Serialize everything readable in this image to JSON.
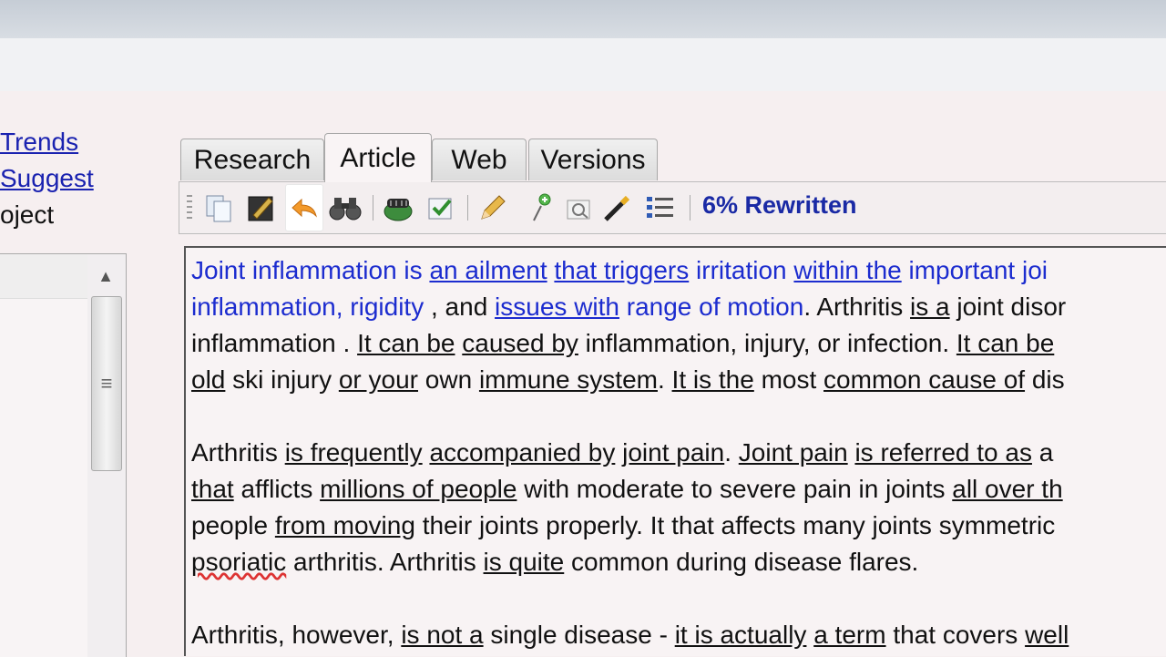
{
  "left": {
    "links": [
      "Trends",
      "Suggest"
    ],
    "static_text": "oject"
  },
  "tabs": [
    {
      "label": "Research",
      "active": false
    },
    {
      "label": "Article",
      "active": true
    },
    {
      "label": "Web",
      "active": false
    },
    {
      "label": "Versions",
      "active": false
    }
  ],
  "toolbar": {
    "icons": [
      "copy-icon",
      "edit-icon",
      "undo-arrow-icon",
      "binoculars-icon",
      "spinner-icon",
      "check-icon",
      "pencil-icon",
      "add-pin-icon",
      "zoom-icon",
      "magic-wand-icon",
      "list-icon"
    ],
    "status": "6% Rewritten",
    "status_color": "#1a2aa5"
  },
  "article": {
    "line1": [
      {
        "t": "Joint inflammation",
        "c": "blue"
      },
      {
        "t": "  is ",
        "c": "blue"
      },
      {
        "t": "an ailment",
        "c": "blue u"
      },
      {
        "t": " ",
        "c": ""
      },
      {
        "t": "that triggers",
        "c": "blue u"
      },
      {
        "t": " irritation ",
        "c": "blue"
      },
      {
        "t": "within the",
        "c": "blue u"
      },
      {
        "t": " important joi",
        "c": "blue"
      }
    ],
    "line2": [
      {
        "t": "inflammation, rigidity ",
        "c": "blue"
      },
      {
        "t": ", and ",
        "c": ""
      },
      {
        "t": "issues with",
        "c": "blue u"
      },
      {
        "t": " range of motion",
        "c": "blue"
      },
      {
        "t": ". Arthritis ",
        "c": ""
      },
      {
        "t": "is a",
        "c": "u"
      },
      {
        "t": " joint disor",
        "c": ""
      }
    ],
    "line3": [
      {
        "t": "inflammation .  ",
        "c": ""
      },
      {
        "t": "It can be",
        "c": "u"
      },
      {
        "t": " ",
        "c": ""
      },
      {
        "t": "caused by",
        "c": "u"
      },
      {
        "t": " inflammation, injury, or infection.  ",
        "c": ""
      },
      {
        "t": "It can be",
        "c": "u"
      }
    ],
    "line4": [
      {
        "t": "old",
        "c": "u"
      },
      {
        "t": " ski injury ",
        "c": ""
      },
      {
        "t": "or your",
        "c": "u"
      },
      {
        "t": " own ",
        "c": ""
      },
      {
        "t": "immune system",
        "c": "u"
      },
      {
        "t": ".  ",
        "c": ""
      },
      {
        "t": "It is the",
        "c": "u"
      },
      {
        "t": " most ",
        "c": ""
      },
      {
        "t": "common cause of",
        "c": "u"
      },
      {
        "t": " dis",
        "c": ""
      }
    ],
    "line5": [
      {
        "t": "Arthritis ",
        "c": ""
      },
      {
        "t": "is frequently",
        "c": "u"
      },
      {
        "t": " ",
        "c": ""
      },
      {
        "t": "accompanied by",
        "c": "u"
      },
      {
        "t": " ",
        "c": ""
      },
      {
        "t": "joint pain",
        "c": "u"
      },
      {
        "t": ". ",
        "c": ""
      },
      {
        "t": "Joint pain",
        "c": "u"
      },
      {
        "t": " ",
        "c": ""
      },
      {
        "t": "is referred to as",
        "c": "u"
      },
      {
        "t": "  a",
        "c": ""
      }
    ],
    "line6": [
      {
        "t": "that",
        "c": "u"
      },
      {
        "t": " afflicts ",
        "c": ""
      },
      {
        "t": "millions of people",
        "c": "u"
      },
      {
        "t": " with moderate to severe pain in joints ",
        "c": ""
      },
      {
        "t": "all over th",
        "c": "u"
      }
    ],
    "line7": [
      {
        "t": "people ",
        "c": ""
      },
      {
        "t": "from moving",
        "c": "u"
      },
      {
        "t": " their joints properly.  It that affects many joints symmetric",
        "c": ""
      }
    ],
    "line8": [
      {
        "t": "psoriatic",
        "c": "sq"
      },
      {
        "t": " arthritis.  Arthritis ",
        "c": ""
      },
      {
        "t": "is quite",
        "c": "u"
      },
      {
        "t": " common during disease flares.",
        "c": ""
      }
    ],
    "line9": [
      {
        "t": "Arthritis, however, ",
        "c": ""
      },
      {
        "t": "is not a",
        "c": "u"
      },
      {
        "t": " single disease - ",
        "c": ""
      },
      {
        "t": "it is actually",
        "c": "u"
      },
      {
        "t": " ",
        "c": ""
      },
      {
        "t": "a term",
        "c": "u"
      },
      {
        "t": " that covers ",
        "c": ""
      },
      {
        "t": "well",
        "c": "u"
      }
    ]
  }
}
